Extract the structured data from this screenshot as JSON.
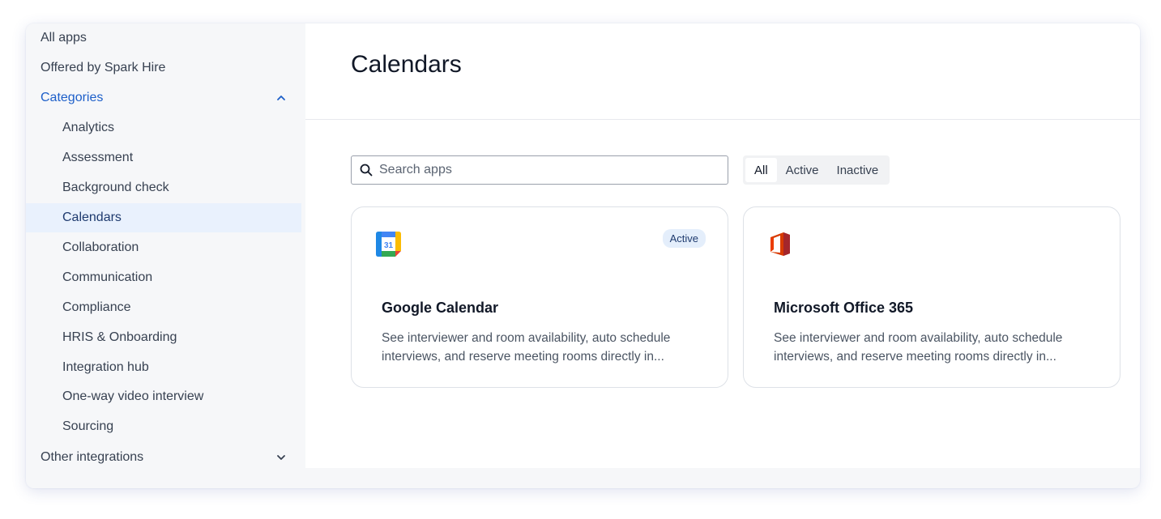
{
  "sidebar": {
    "top_items": {
      "all_apps": "All apps",
      "offered": "Offered by Spark Hire",
      "categories": "Categories",
      "other": "Other integrations"
    },
    "categories": [
      "Analytics",
      "Assessment",
      "Background check",
      "Calendars",
      "Collaboration",
      "Communication",
      "Compliance",
      "HRIS & Onboarding",
      "Integration hub",
      "One-way video interview",
      "Sourcing"
    ],
    "selected_category": "Calendars",
    "categories_expanded": true
  },
  "main": {
    "title": "Calendars",
    "search": {
      "placeholder": "Search apps",
      "value": ""
    },
    "filters": {
      "all": "All",
      "active": "Active",
      "inactive": "Inactive",
      "selected": "All"
    },
    "cards": [
      {
        "icon": "google-calendar-icon",
        "icon_text": "31",
        "badge": "Active",
        "title": "Google Calendar",
        "description": "See interviewer and room availability, auto schedule interviews, and reserve meeting rooms directly in..."
      },
      {
        "icon": "microsoft-office-icon",
        "badge": "",
        "title": "Microsoft Office 365",
        "description": "See interviewer and room availability, auto schedule interviews, and reserve meeting rooms directly in..."
      }
    ]
  },
  "colors": {
    "accent": "#1d5fc9",
    "selected_bg": "#e9f1fd",
    "badge_bg": "#e4eefb"
  }
}
